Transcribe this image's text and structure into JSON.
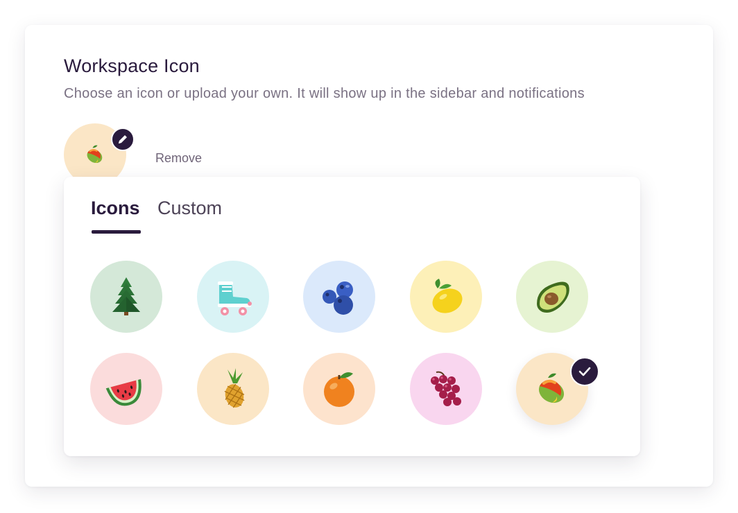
{
  "header": {
    "title": "Workspace Icon",
    "subtitle": "Choose an icon or upload your own. It will show up in the sidebar and notifications"
  },
  "current_icon": {
    "icon": "mango-icon",
    "background": "#fbe6c6",
    "edit_icon": "pencil-icon",
    "remove_label": "Remove"
  },
  "tabs": [
    {
      "label": "Icons",
      "active": true
    },
    {
      "label": "Custom",
      "active": false
    }
  ],
  "icons": [
    {
      "name": "tree-icon",
      "background": "#d4e8d8",
      "selected": false
    },
    {
      "name": "roller-skate-icon",
      "background": "#d9f3f5",
      "selected": false
    },
    {
      "name": "blueberries-icon",
      "background": "#dbe9fb",
      "selected": false
    },
    {
      "name": "lemon-icon",
      "background": "#fdf0b8",
      "selected": false
    },
    {
      "name": "avocado-icon",
      "background": "#e6f3d2",
      "selected": false
    },
    {
      "name": "watermelon-icon",
      "background": "#fbdcdc",
      "selected": false
    },
    {
      "name": "pineapple-icon",
      "background": "#fbe6c6",
      "selected": false
    },
    {
      "name": "orange-icon",
      "background": "#fde3cd",
      "selected": false
    },
    {
      "name": "grapes-icon",
      "background": "#f9d6ef",
      "selected": false
    },
    {
      "name": "mango-icon",
      "background": "#fbe6c6",
      "selected": true
    }
  ],
  "colors": {
    "accent": "#2a1b3d",
    "muted_text": "#7a7183"
  }
}
